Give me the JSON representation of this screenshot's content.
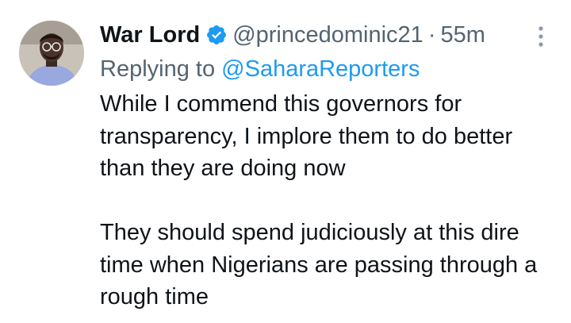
{
  "tweet": {
    "author_name": "War Lord",
    "handle": "@princedominic21",
    "separator": "·",
    "time": "55m",
    "replying_prefix": "Replying to ",
    "replying_handle": "@SaharaReporters",
    "paragraphs": [
      "While I commend this governors for transparency, I implore them to do better than they are doing now",
      "They should spend judiciously at this dire time when Nigerians are passing through a rough time"
    ],
    "icons": {
      "verified": "verified-badge-icon",
      "more": "more-vertical-icon"
    }
  },
  "colors": {
    "text_primary": "#0f1419",
    "text_secondary": "#536471",
    "accent": "#1d9bf0"
  }
}
